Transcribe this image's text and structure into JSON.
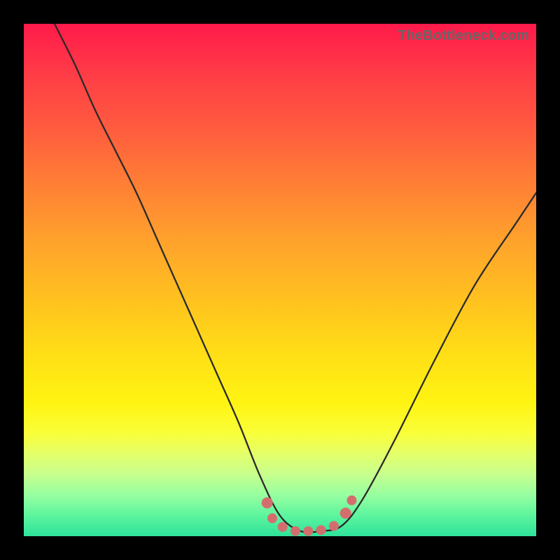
{
  "watermark": "TheBottleneck.com",
  "chart_data": {
    "type": "line",
    "title": "",
    "xlabel": "",
    "ylabel": "",
    "xlim": [
      0,
      1
    ],
    "ylim": [
      0,
      1
    ],
    "series": [
      {
        "name": "curve",
        "x": [
          0.06,
          0.1,
          0.14,
          0.18,
          0.22,
          0.26,
          0.3,
          0.34,
          0.38,
          0.42,
          0.46,
          0.5,
          0.54,
          0.58,
          0.62,
          0.66,
          0.72,
          0.8,
          0.88,
          0.96,
          1.0
        ],
        "y": [
          1.0,
          0.92,
          0.83,
          0.75,
          0.67,
          0.58,
          0.49,
          0.4,
          0.31,
          0.22,
          0.12,
          0.04,
          0.01,
          0.01,
          0.02,
          0.07,
          0.18,
          0.34,
          0.49,
          0.61,
          0.67
        ]
      }
    ],
    "markers": [
      {
        "x": 0.475,
        "y": 0.065,
        "r": 8
      },
      {
        "x": 0.485,
        "y": 0.035,
        "r": 7
      },
      {
        "x": 0.505,
        "y": 0.018,
        "r": 7
      },
      {
        "x": 0.53,
        "y": 0.01,
        "r": 7
      },
      {
        "x": 0.555,
        "y": 0.01,
        "r": 7
      },
      {
        "x": 0.58,
        "y": 0.012,
        "r": 7
      },
      {
        "x": 0.605,
        "y": 0.02,
        "r": 7
      },
      {
        "x": 0.628,
        "y": 0.045,
        "r": 8
      },
      {
        "x": 0.64,
        "y": 0.07,
        "r": 7
      }
    ],
    "colors": {
      "gradient_top": "#ff1a4b",
      "gradient_mid": "#ffe016",
      "gradient_bottom": "#2fe29a",
      "curve": "#2a2a2a",
      "markers": "#d46e6e"
    }
  }
}
